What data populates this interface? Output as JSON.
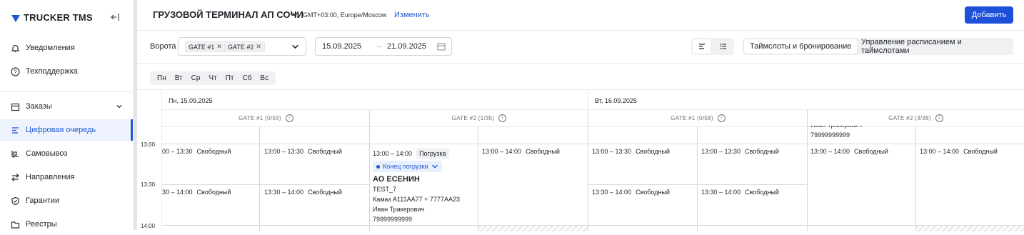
{
  "brand": {
    "logo_text": "TRUCKER TMS"
  },
  "sidebar": {
    "items": [
      {
        "label": "Уведомления",
        "icon": "bell-icon"
      },
      {
        "label": "Техподдержка",
        "icon": "help-circle-icon"
      },
      {
        "label": "Заказы",
        "icon": "calendar-icon"
      },
      {
        "label": "Цифровая очередь",
        "icon": "queue-icon",
        "active": true
      },
      {
        "label": "Самовывоз",
        "icon": "pickup-icon"
      },
      {
        "label": "Направления",
        "icon": "arrows-icon"
      },
      {
        "label": "Гарантии",
        "icon": "shield-icon"
      },
      {
        "label": "Реестры",
        "icon": "folder-icon"
      }
    ]
  },
  "header": {
    "terminal": "ГРУЗОВОЙ ТЕРМИНАЛ АП СОЧИ",
    "timezone": "GMT+03:00, Europe/Moscow",
    "change_link": "Изменить",
    "add_button": "Добавить"
  },
  "filters": {
    "gates_label": "Ворота",
    "gates": [
      "GATE #1",
      "GATE #2"
    ],
    "date_from": "15.09.2025",
    "date_to": "21.09.2025",
    "date_arrow": "→",
    "mode_tabs": [
      "Таймслоты и бронирование",
      "Управление расписанием и таймслотами"
    ]
  },
  "weekdays": [
    "Пн",
    "Вт",
    "Ср",
    "Чт",
    "Пт",
    "Сб",
    "Вс"
  ],
  "schedule": {
    "times": [
      "13:00",
      "13:30",
      "14:00"
    ],
    "dates": [
      "Пн, 15.09.2025",
      "Вт, 16.09.2025"
    ],
    "gate_headers": [
      "GATE #1 (0/59)",
      "GATE #2 (1/35)",
      "GATE #1 (0/58)",
      "GATE #2 (3/36)"
    ],
    "slots": {
      "s1": "00 – 13:30",
      "s2": "13:00 – 13:30",
      "s3": "13:00 – 14:00",
      "s4": "30 – 14:00",
      "s5": "13:30 – 14:00",
      "free": "Свободный"
    },
    "booking": {
      "time": "13:00 – 14:00",
      "type": "Погрузка",
      "status": "Конец погрузки",
      "company": "АО ЕСЕНИН",
      "ref": "TEST_7",
      "vehicle": "Камаз А111АА77 + 7777АА23",
      "driver": "Иван Тракерович",
      "phone": "79999999999"
    },
    "top_overflow": {
      "driver": "Иван Тракерович",
      "phone": "79999999999"
    }
  }
}
